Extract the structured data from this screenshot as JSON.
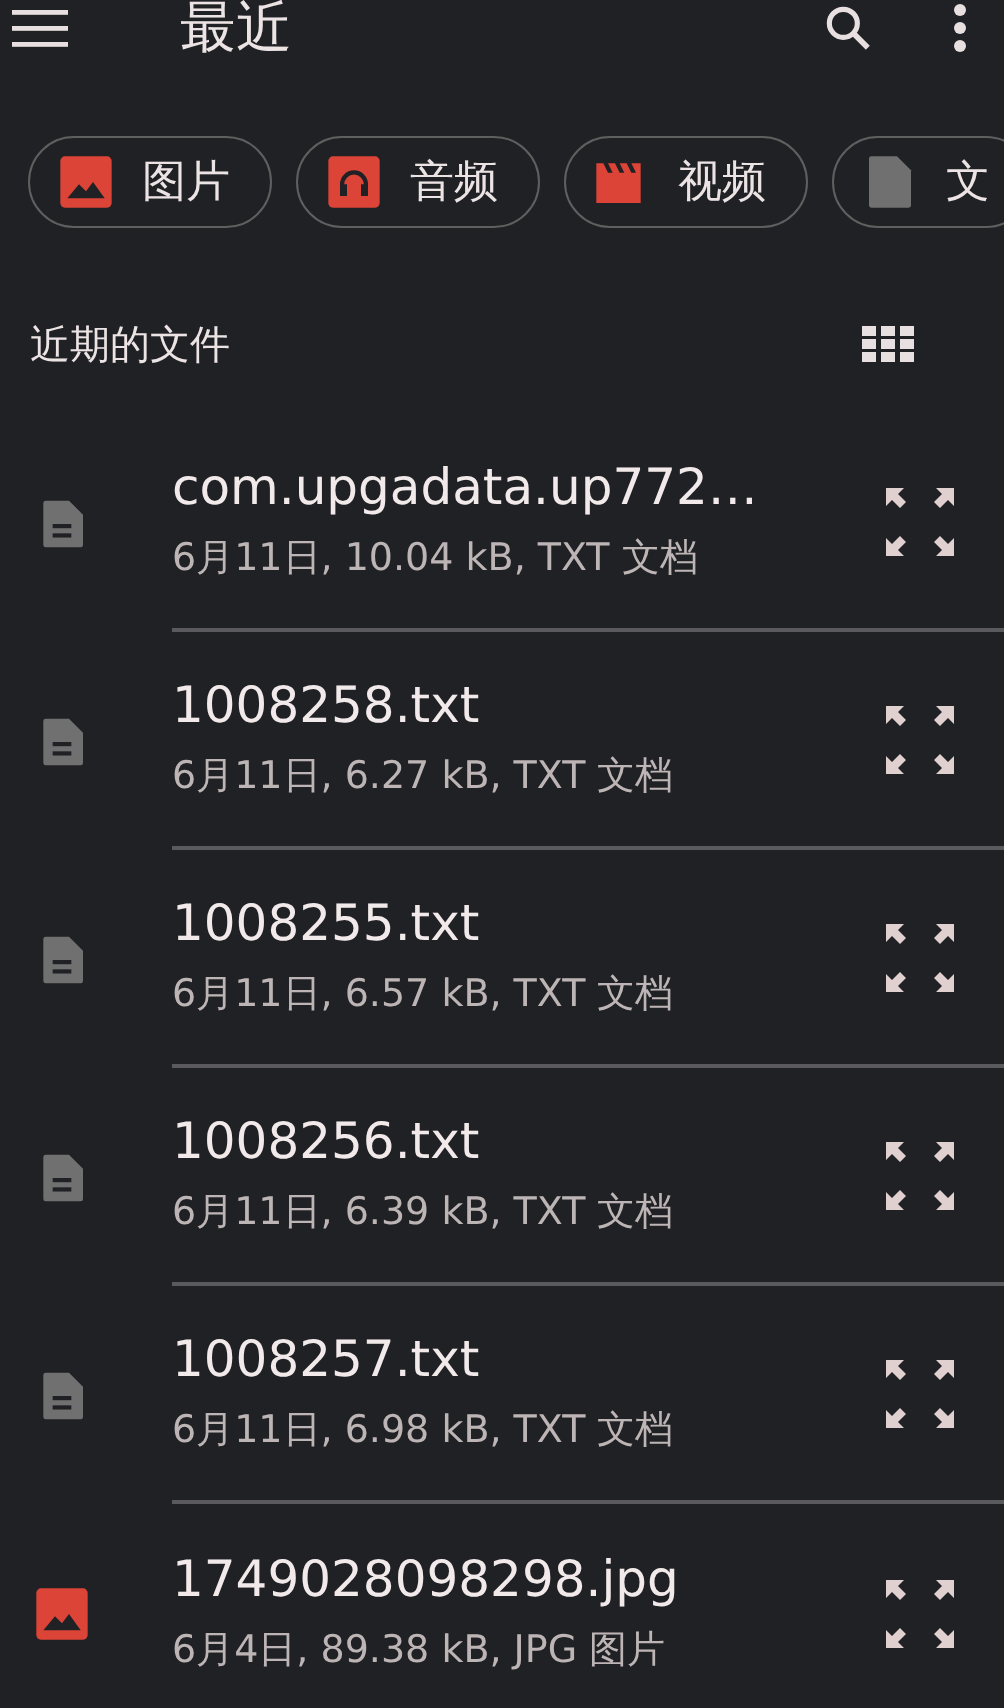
{
  "app_bar": {
    "title": "最近"
  },
  "chips": [
    {
      "kind": "image",
      "label": "图片"
    },
    {
      "kind": "audio",
      "label": "音频"
    },
    {
      "kind": "video",
      "label": "视频"
    },
    {
      "kind": "doc",
      "label": "文"
    }
  ],
  "section": {
    "title": "近期的文件"
  },
  "files": [
    {
      "kind": "doc",
      "name": "com.upgadata.up772…",
      "meta": "6月11日, 10.04 kB, TXT 文档"
    },
    {
      "kind": "doc",
      "name": "1008258.txt",
      "meta": "6月11日, 6.27 kB, TXT 文档"
    },
    {
      "kind": "doc",
      "name": "1008255.txt",
      "meta": "6月11日, 6.57 kB, TXT 文档"
    },
    {
      "kind": "doc",
      "name": "1008256.txt",
      "meta": "6月11日, 6.39 kB, TXT 文档"
    },
    {
      "kind": "doc",
      "name": "1008257.txt",
      "meta": "6月11日, 6.98 kB, TXT 文档"
    },
    {
      "kind": "image",
      "name": "1749028098298.jpg",
      "meta": "6月4日, 89.38 kB, JPG 图片"
    }
  ]
}
